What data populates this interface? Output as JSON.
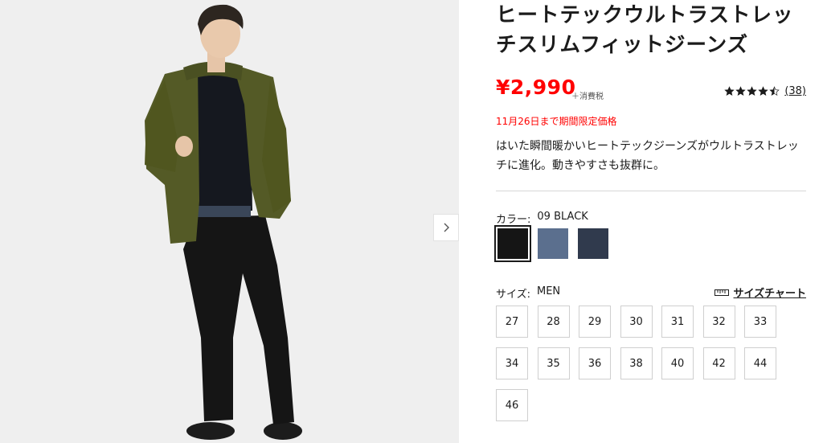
{
  "product": {
    "title": "ヒートテックウルトラストレッチスリムフィットジーンズ",
    "price": "¥2,990",
    "tax_note": "＋消費税",
    "rating_value": 4.5,
    "review_count": "(38)",
    "promo": "11月26日まで期間限定価格",
    "description": "はいた瞬間暖かいヒートテックジーンズがウルトラストレッチに進化。動きやすさも抜群に。"
  },
  "gallery": {
    "next_icon": "chevron-right-icon"
  },
  "color": {
    "label": "カラー:",
    "selected": "09 BLACK",
    "swatches": [
      {
        "name": "black",
        "color": "#151515",
        "selected": true
      },
      {
        "name": "blue",
        "color": "#5b6f8e",
        "selected": false
      },
      {
        "name": "navy",
        "color": "#303a4d",
        "selected": false
      }
    ]
  },
  "size": {
    "label": "サイズ:",
    "selected": "MEN",
    "chart_label": "サイズチャート",
    "chart_icon": "ruler-icon",
    "options": [
      "27",
      "28",
      "29",
      "30",
      "31",
      "32",
      "33",
      "34",
      "35",
      "36",
      "38",
      "40",
      "42",
      "44",
      "46"
    ]
  }
}
